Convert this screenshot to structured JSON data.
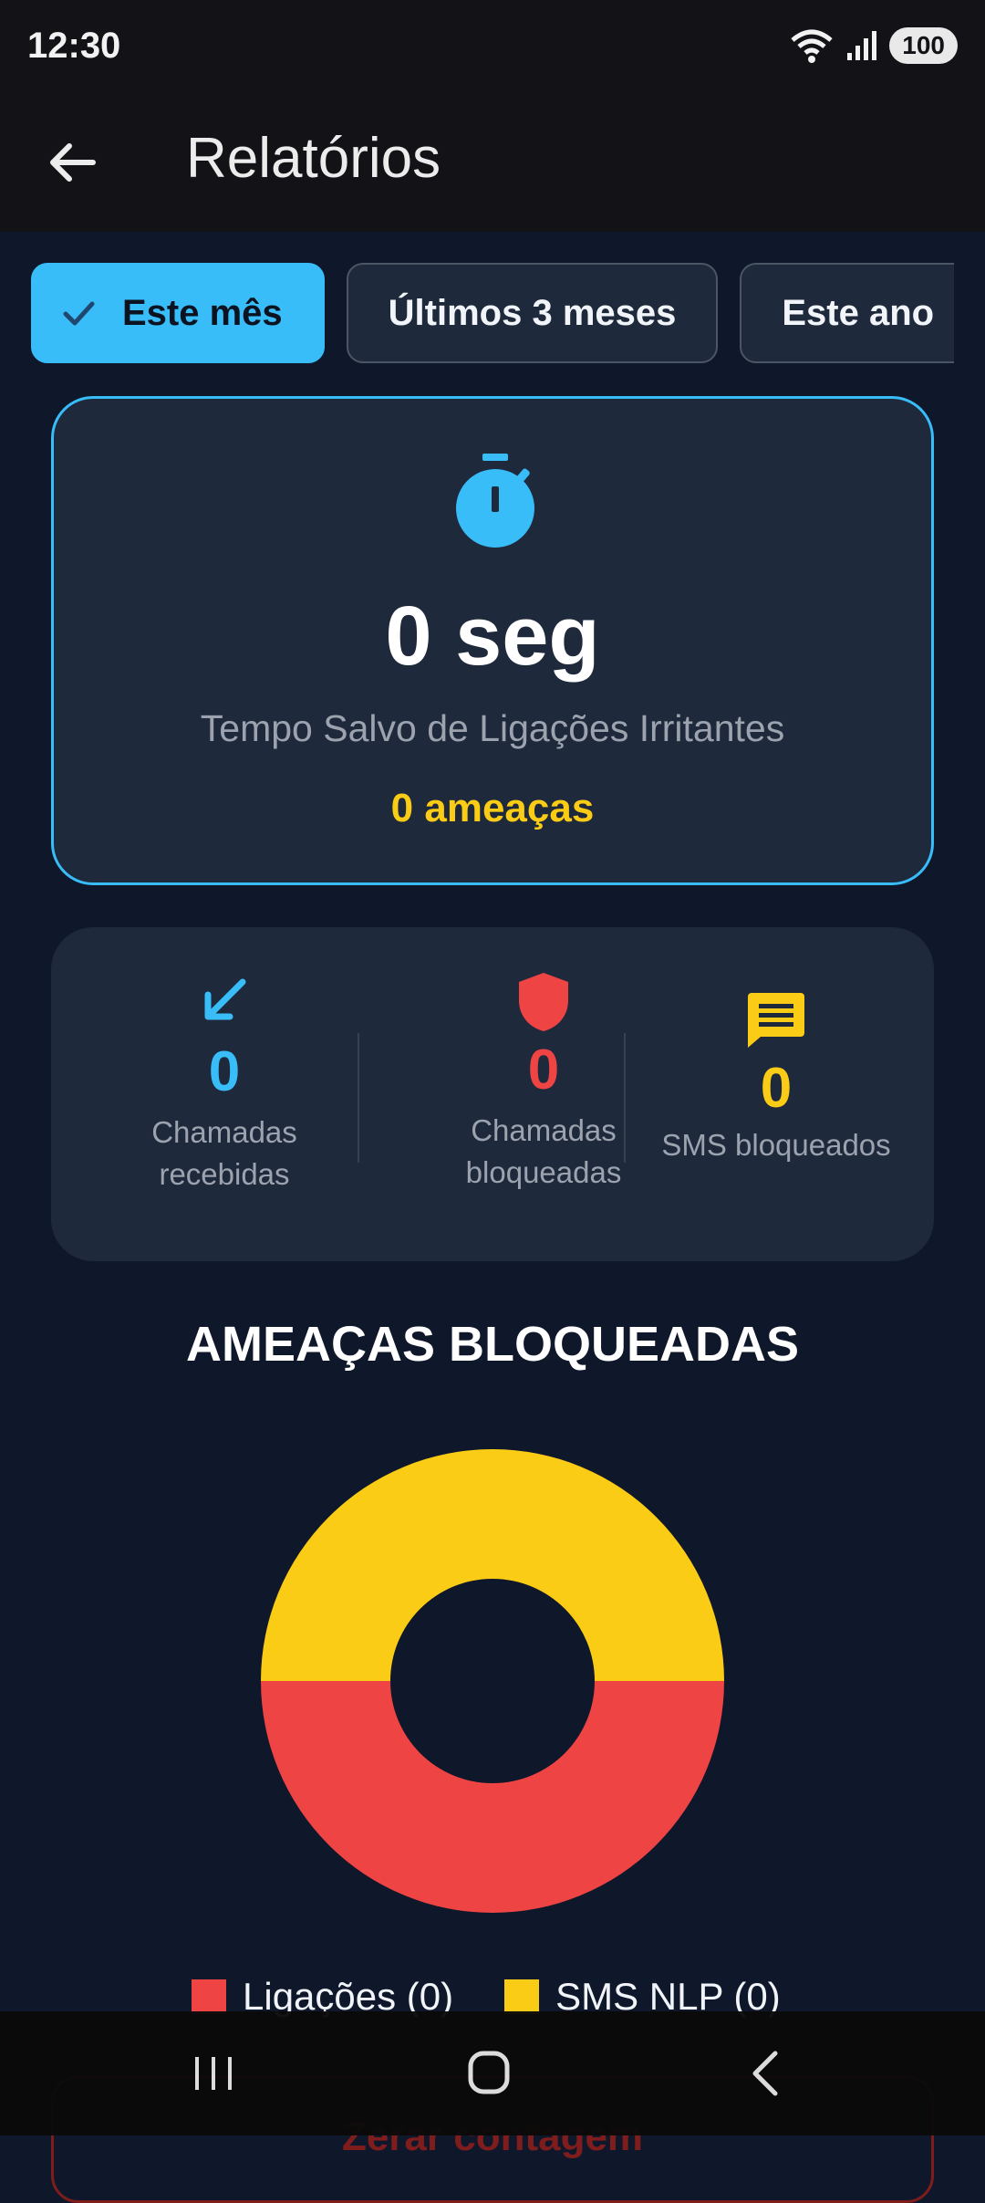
{
  "status_bar": {
    "time": "12:30",
    "battery": "100",
    "wifi_badge": "5"
  },
  "app_bar": {
    "title": "Relatórios",
    "back_icon": "arrow-left-icon"
  },
  "filters": [
    {
      "label": "Este mês",
      "selected": true
    },
    {
      "label": "Últimos 3 meses",
      "selected": false
    },
    {
      "label": "Este ano",
      "selected": false
    }
  ],
  "summary": {
    "icon": "stopwatch-icon",
    "time_saved": "0 seg",
    "label": "Tempo Salvo de Ligações Irritantes",
    "threats": "0 ameaças"
  },
  "stats": [
    {
      "icon": "arrow-down-left-icon",
      "value": "0",
      "label_line1": "Chamadas",
      "label_line2": "recebidas",
      "color": "#38bdf8"
    },
    {
      "icon": "shield-icon",
      "value": "0",
      "label_line1": "Chamadas",
      "label_line2": "bloqueadas",
      "color": "#ef4444"
    },
    {
      "icon": "message-icon",
      "value": "0",
      "label_line1": "SMS bloqueados",
      "label_line2": "",
      "color": "#facc15"
    }
  ],
  "section_title": "AMEAÇAS BLOQUEADAS",
  "chart_data": {
    "type": "pie",
    "donut": true,
    "categories": [
      "Ligações",
      "SMS NLP"
    ],
    "values": [
      0,
      0
    ],
    "colors": [
      "#ef4444",
      "#facc15"
    ],
    "legend": [
      "Ligações (0)",
      "SMS NLP (0)"
    ],
    "legend_position": "bottom"
  },
  "reset_button": {
    "label": "Zerar contagem"
  },
  "nav": {
    "recents": "recents-icon",
    "home": "home-icon",
    "back": "back-icon"
  }
}
